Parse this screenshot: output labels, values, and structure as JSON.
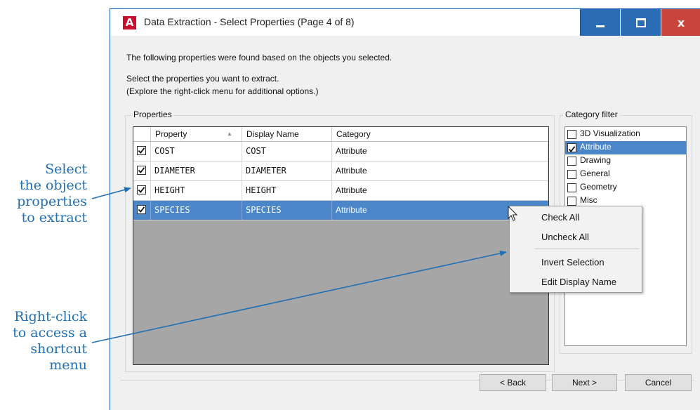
{
  "callouts": {
    "first": [
      "Select",
      "the object",
      "properties",
      "to extract"
    ],
    "second": [
      "Right-click",
      "to access a",
      "shortcut",
      "menu"
    ]
  },
  "window": {
    "title": "Data Extraction - Select Properties (Page 4 of 8)",
    "close_symbol": "x"
  },
  "text": {
    "intro": "The following properties were found based on the objects you selected.",
    "instruction1": "Select the properties you want to extract.",
    "instruction2": "(Explore the right-click menu for additional options.)"
  },
  "properties": {
    "group_label": "Properties",
    "headers": [
      "Property",
      "Display Name",
      "Category"
    ],
    "rows": [
      {
        "checked": true,
        "property": "COST",
        "display_name": "COST",
        "category": "Attribute",
        "selected": false
      },
      {
        "checked": true,
        "property": "DIAMETER",
        "display_name": "DIAMETER",
        "category": "Attribute",
        "selected": false
      },
      {
        "checked": true,
        "property": "HEIGHT",
        "display_name": "HEIGHT",
        "category": "Attribute",
        "selected": false
      },
      {
        "checked": true,
        "property": "SPECIES",
        "display_name": "SPECIES",
        "category": "Attribute",
        "selected": true
      }
    ]
  },
  "category_filter": {
    "label": "Category filter",
    "items": [
      {
        "label": "3D Visualization",
        "checked": false,
        "selected": false
      },
      {
        "label": "Attribute",
        "checked": true,
        "selected": true
      },
      {
        "label": "Drawing",
        "checked": false,
        "selected": false
      },
      {
        "label": "General",
        "checked": false,
        "selected": false
      },
      {
        "label": "Geometry",
        "checked": false,
        "selected": false
      },
      {
        "label": "Misc",
        "checked": false,
        "selected": false
      }
    ]
  },
  "context_menu": {
    "items": [
      "Check All",
      "Uncheck All",
      "Invert Selection",
      "Edit Display Name"
    ]
  },
  "buttons": {
    "back": "< Back",
    "next": "Next >",
    "cancel": "Cancel"
  },
  "colors": {
    "accent": "#2b6cb7",
    "selection": "#4a86c8",
    "callout": "#1f6fb5",
    "close": "#c8453b"
  }
}
